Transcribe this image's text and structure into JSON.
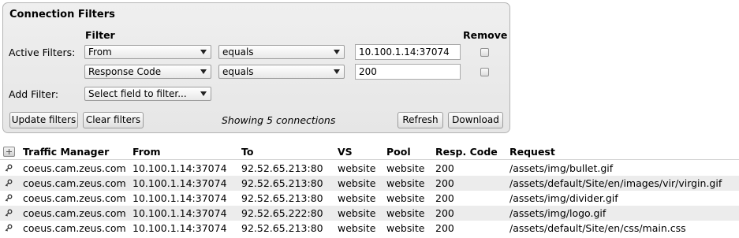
{
  "panel": {
    "title": "Connection Filters",
    "filter_header": "Filter",
    "remove_header": "Remove",
    "active_label": "Active Filters:",
    "add_label": "Add Filter:",
    "filters": [
      {
        "field": "From",
        "operator": "equals",
        "value": "10.100.1.14:37074"
      },
      {
        "field": "Response Code",
        "operator": "equals",
        "value": "200"
      }
    ],
    "add_placeholder": "Select field to filter...",
    "buttons": {
      "update": "Update filters",
      "clear": "Clear filters",
      "refresh": "Refresh",
      "download": "Download"
    },
    "status": "Showing 5 connections"
  },
  "table": {
    "columns": [
      "Traffic Manager",
      "From",
      "To",
      "VS",
      "Pool",
      "Resp. Code",
      "Request"
    ],
    "rows": [
      [
        "coeus.cam.zeus.com",
        "10.100.1.14:37074",
        "92.52.65.213:80",
        "website",
        "website",
        "200",
        "/assets/img/bullet.gif"
      ],
      [
        "coeus.cam.zeus.com",
        "10.100.1.14:37074",
        "92.52.65.213:80",
        "website",
        "website",
        "200",
        "/assets/default/Site/en/images/vir/virgin.gif"
      ],
      [
        "coeus.cam.zeus.com",
        "10.100.1.14:37074",
        "92.52.65.213:80",
        "website",
        "website",
        "200",
        "/assets/img/divider.gif"
      ],
      [
        "coeus.cam.zeus.com",
        "10.100.1.14:37074",
        "92.52.65.222:80",
        "website",
        "website",
        "200",
        "/assets/img/logo.gif"
      ],
      [
        "coeus.cam.zeus.com",
        "10.100.1.14:37074",
        "92.52.65.213:80",
        "website",
        "website",
        "200",
        "/assets/default/Site/en/css/main.css"
      ]
    ]
  },
  "icons": {
    "expand": "plus-icon",
    "row": "key-icon"
  },
  "colors": {
    "panel_bg": "#e9e9e9",
    "alt_row_bg": "#ececec"
  }
}
